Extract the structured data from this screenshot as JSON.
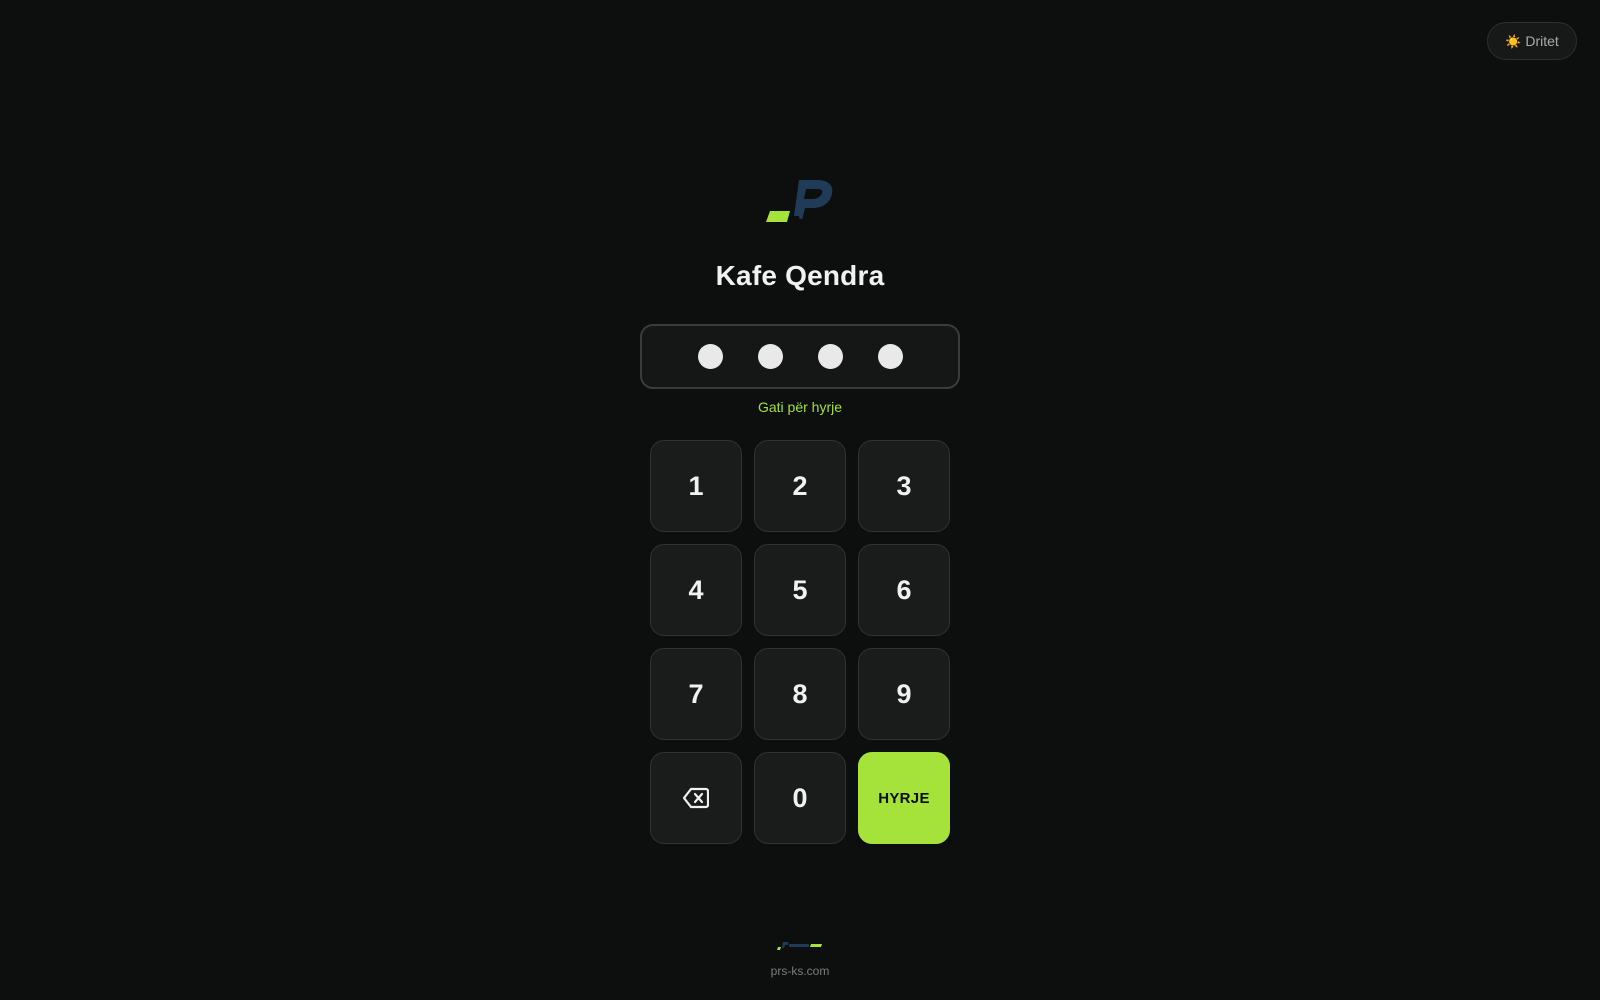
{
  "theme_toggle": {
    "icon": "sun-icon",
    "icon_glyph": "☀️",
    "label": "Dritet"
  },
  "brand": {
    "logo": "prs-logo",
    "name": "Kafe Qendra",
    "colors": {
      "accent": "#a6e33a",
      "logo_blue": "#1f3b57"
    }
  },
  "pin": {
    "length": 4,
    "filled": 4,
    "status": "Gati për hyrje"
  },
  "keypad": {
    "keys": [
      {
        "label": "1",
        "name": "key-1"
      },
      {
        "label": "2",
        "name": "key-2"
      },
      {
        "label": "3",
        "name": "key-3"
      },
      {
        "label": "4",
        "name": "key-4"
      },
      {
        "label": "5",
        "name": "key-5"
      },
      {
        "label": "6",
        "name": "key-6"
      },
      {
        "label": "7",
        "name": "key-7"
      },
      {
        "label": "8",
        "name": "key-8"
      },
      {
        "label": "9",
        "name": "key-9"
      }
    ],
    "backspace": {
      "icon": "backspace-icon"
    },
    "zero": "0",
    "enter": "HYRJE"
  },
  "footer": {
    "logo": "prs-it-logo",
    "url": "prs-ks.com"
  }
}
